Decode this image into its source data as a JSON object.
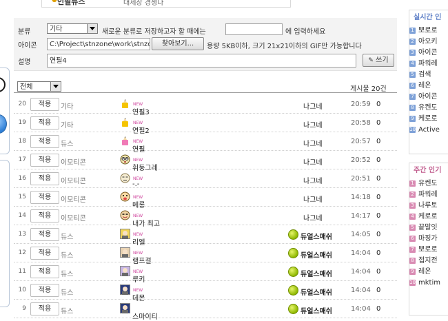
{
  "top_fragment": {
    "title": "인필뉴스",
    "text": "대세장 경쟁다"
  },
  "form": {
    "category_label": "분류",
    "category_value": "기타",
    "new_category_prefix": "새로운 분류로 저장하고자 할 때에는",
    "new_category_suffix": "에 입력하세요",
    "new_category_value": "",
    "icon_label": "아이콘",
    "icon_path": "C:\\Project\\stnzone\\work\\stnzon",
    "browse_label": "찾아보기...",
    "icon_note": "용량 5KB이하, 크기 21x21이하의 GIF만 가능합니다",
    "desc_label": "설명",
    "desc_value": "연필4",
    "write_label": "쓰기",
    "write_icon": "pencil-icon"
  },
  "list": {
    "filter_value": "전체",
    "count_label": "게시물 20건",
    "apply_label": "적용",
    "new_badge": "NEW",
    "rows": [
      {
        "num": "20",
        "cat": "기타",
        "emoji": "pencil-yellow",
        "name": "연필3",
        "new": true,
        "user": "나그네",
        "special": false,
        "time": "20:59",
        "count": "0"
      },
      {
        "num": "19",
        "cat": "기타",
        "emoji": "pencil-yellow",
        "name": "연필2",
        "new": true,
        "user": "나그네",
        "special": false,
        "time": "20:58",
        "count": "0"
      },
      {
        "num": "18",
        "cat": "듀스",
        "emoji": "pencil-pink",
        "name": "연필",
        "new": true,
        "user": "나그네",
        "special": false,
        "time": "20:57",
        "count": "0"
      },
      {
        "num": "17",
        "cat": "이모티콘",
        "emoji": "face-dizzy",
        "name": "휘둥그레",
        "new": true,
        "user": "나그네",
        "special": false,
        "time": "20:52",
        "count": "0"
      },
      {
        "num": "16",
        "cat": "이모티콘",
        "emoji": "face-meh",
        "name": "-.-",
        "new": true,
        "user": "나그네",
        "special": false,
        "time": "20:51",
        "count": "0"
      },
      {
        "num": "15",
        "cat": "이모티콘",
        "emoji": "face-tongue",
        "name": "메롱",
        "new": true,
        "user": "나그네",
        "special": false,
        "time": "14:18",
        "count": "0"
      },
      {
        "num": "14",
        "cat": "이모티콘",
        "emoji": "face-proud",
        "name": "내가 최고",
        "new": true,
        "user": "나그네",
        "special": false,
        "time": "14:17",
        "count": "0"
      },
      {
        "num": "13",
        "cat": "듀스",
        "emoji": "avatar-yellow",
        "name": "리엘",
        "new": true,
        "user": "듀얼스매쉬",
        "special": true,
        "time": "14:05",
        "count": "0"
      },
      {
        "num": "12",
        "cat": "듀스",
        "emoji": "avatar-beige",
        "name": "램프걸",
        "new": true,
        "user": "듀얼스매쉬",
        "special": true,
        "time": "14:04",
        "count": "0"
      },
      {
        "num": "11",
        "cat": "듀스",
        "emoji": "avatar-lilac",
        "name": "루키",
        "new": true,
        "user": "듀얼스매쉬",
        "special": true,
        "time": "14:04",
        "count": "0"
      },
      {
        "num": "10",
        "cat": "듀스",
        "emoji": "avatar-navy",
        "name": "데몬",
        "new": true,
        "user": "듀얼스매쉬",
        "special": true,
        "time": "14:04",
        "count": "0"
      },
      {
        "num": "9",
        "cat": "듀스",
        "emoji": "avatar-navy",
        "name": "스마이티",
        "new": false,
        "user": "듀얼스매쉬",
        "special": true,
        "time": "14:04",
        "count": "0"
      }
    ]
  },
  "sidebar_realtime": {
    "title": "실시간 인",
    "items": [
      "뽀로로",
      "아오키",
      "아이콘",
      "파워레",
      "검색",
      "레온",
      "아이콘",
      "유켄도",
      "케로로",
      "Active"
    ]
  },
  "sidebar_weekly": {
    "title": "주간 인기",
    "items": [
      "유켄도",
      "파워레",
      "나루토",
      "케로로",
      "끝말잇",
      "마징가",
      "뽀로로",
      "접지전",
      "레온",
      "mktim"
    ]
  },
  "colors": {
    "realtime_title": "#5c7ec6",
    "weekly_title": "#c05a8c",
    "rank_blue": "#7fa2d8",
    "rank_pink": "#d98bb3"
  }
}
